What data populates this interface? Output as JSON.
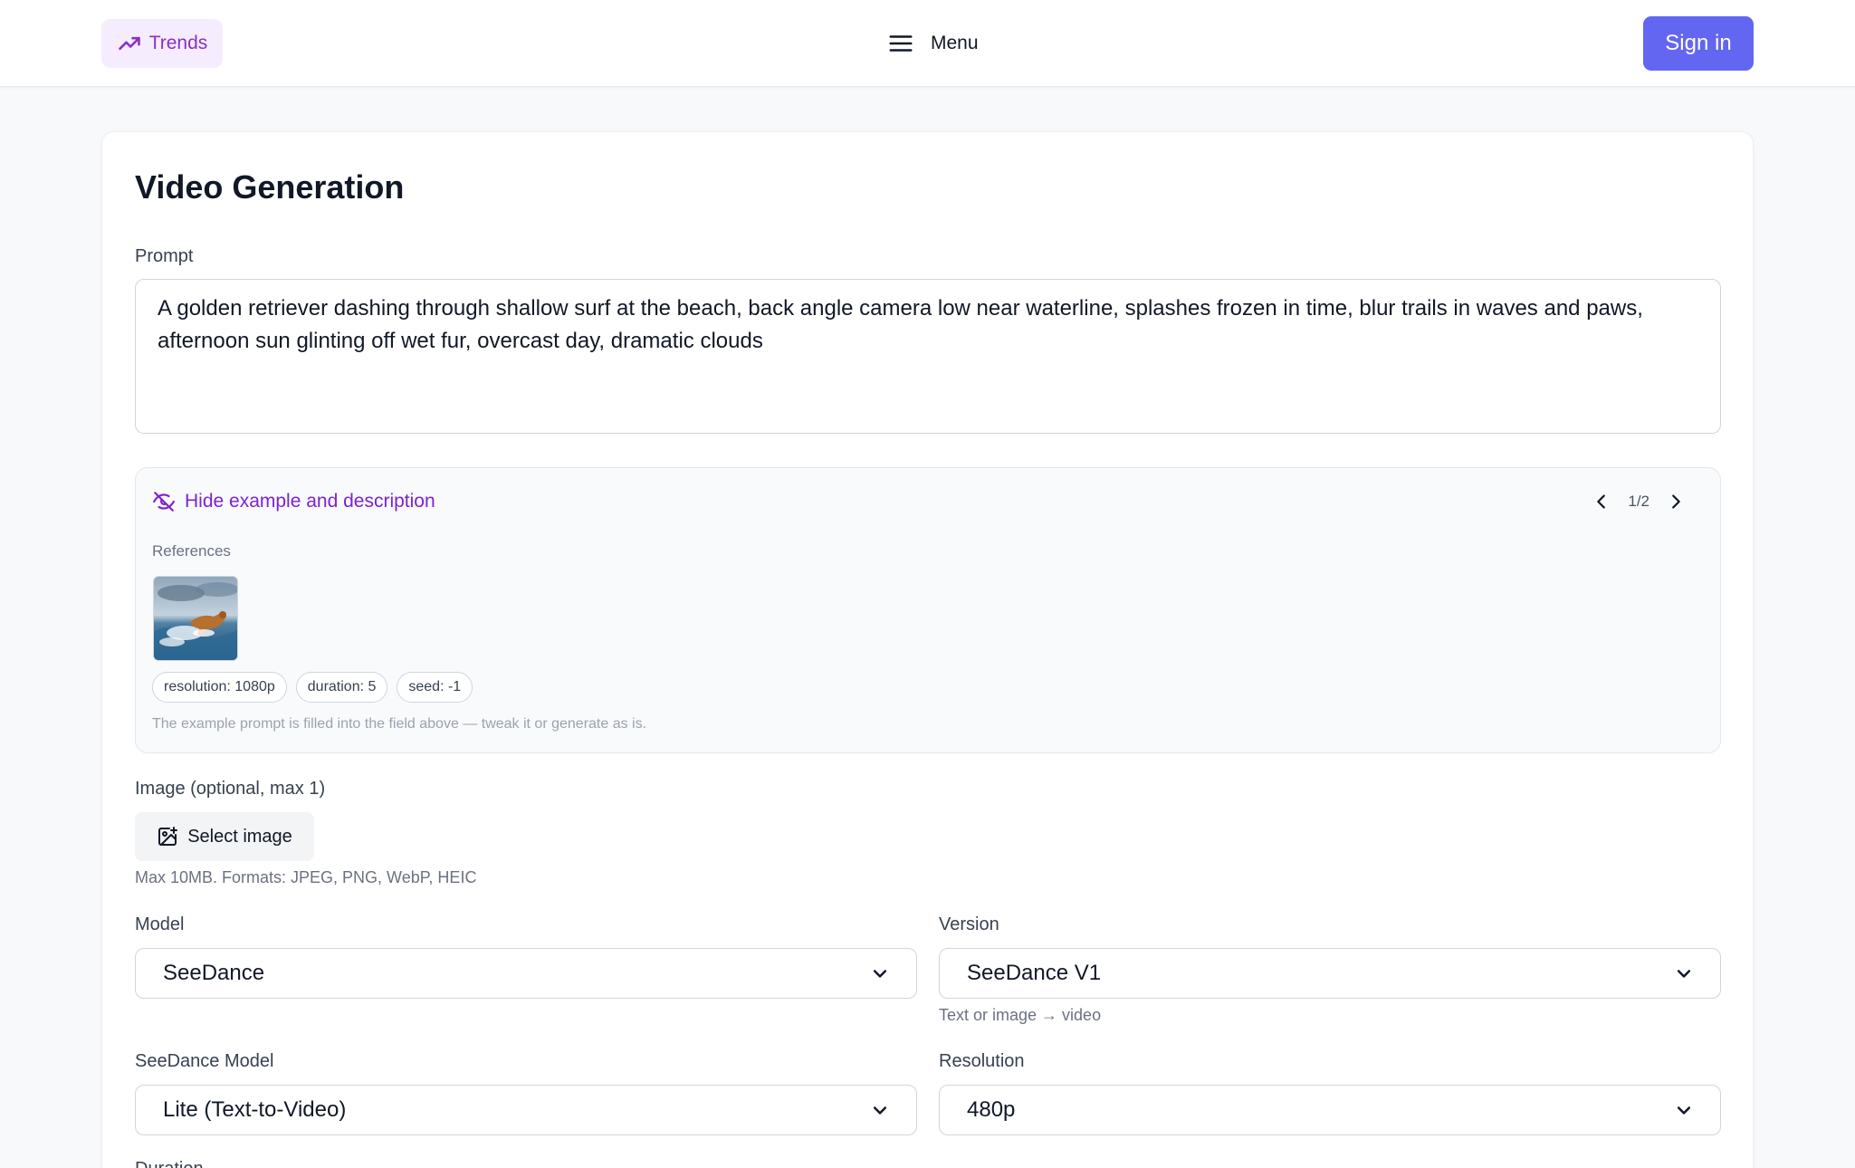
{
  "header": {
    "trends_label": "Trends",
    "menu_label": "Menu",
    "signin_label": "Sign in"
  },
  "page": {
    "title": "Video Generation"
  },
  "prompt": {
    "label": "Prompt",
    "value": "A golden retriever dashing through shallow surf at the beach, back angle camera low near waterline, splashes frozen in time, blur trails in waves and paws, afternoon sun glinting off wet fur, overcast day, dramatic clouds"
  },
  "example": {
    "hide_label": "Hide example and description",
    "page_indicator": "1/2",
    "references_label": "References",
    "chips": [
      "resolution: 1080p",
      "duration: 5",
      "seed: -1"
    ],
    "hint": "The example prompt is filled into the field above — tweak it or generate as is."
  },
  "image_upload": {
    "label": "Image (optional, max 1)",
    "button_label": "Select image",
    "note": "Max 10MB. Formats: JPEG, PNG, WebP, HEIC"
  },
  "model": {
    "label": "Model",
    "value": "SeeDance"
  },
  "version": {
    "label": "Version",
    "value": "SeeDance V1",
    "note": "Text or image → video"
  },
  "seedance_model": {
    "label": "SeeDance Model",
    "value": "Lite (Text-to-Video)"
  },
  "resolution": {
    "label": "Resolution",
    "value": "480p"
  },
  "duration": {
    "label": "Duration"
  },
  "colors": {
    "accent": "#6366f1",
    "purple": "#7e22ce",
    "trends_bg": "#f5edfd"
  }
}
